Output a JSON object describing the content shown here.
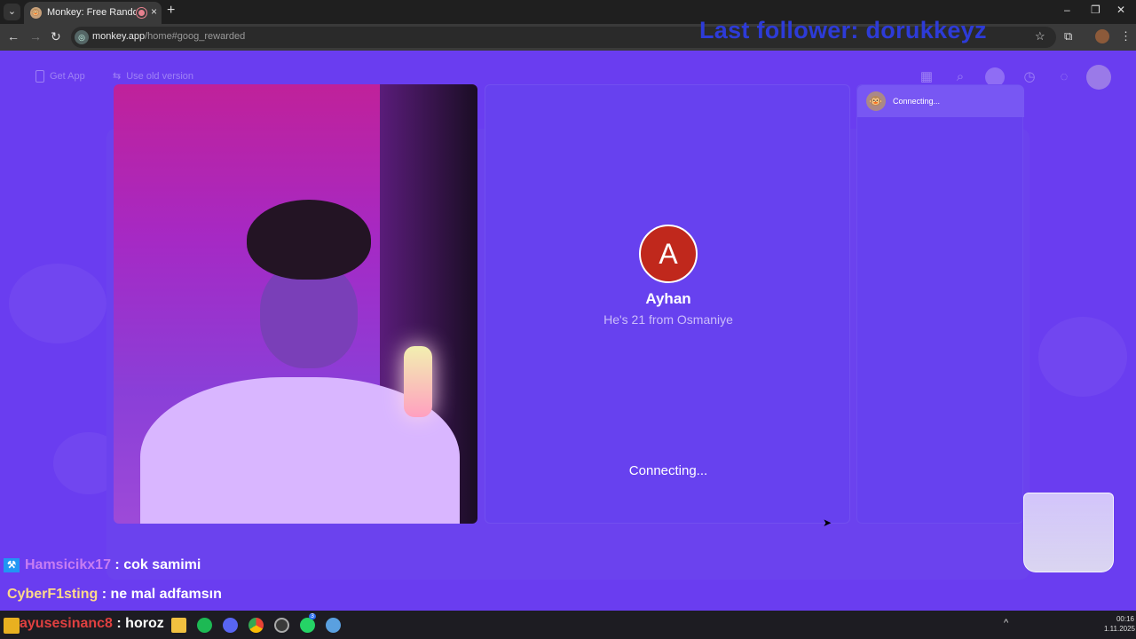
{
  "browser": {
    "tab_title": "Monkey: Free Random Vide",
    "url_host": "monkey.app",
    "url_path": "/home#goog_rewarded",
    "new_tab": "+",
    "close": "×"
  },
  "stream_overlay": {
    "last_follower": "Last follower: dorukkeyz",
    "chat": [
      {
        "user": "Hamsicikx17",
        "message": " : cok samimi"
      },
      {
        "user": "CyberF1sting",
        "message": " : ne mal adfamsın"
      },
      {
        "user": "ayusesinanc8",
        "message": " : horoz"
      }
    ]
  },
  "page_nav": {
    "get_app": "Get App",
    "old_version": "Use old version"
  },
  "match": {
    "avatar_letter": "A",
    "name": "Ayhan",
    "subtitle": "He's 21 from Osmaniye",
    "status": "Connecting..."
  },
  "chat_panel": {
    "status": "Connecting..."
  },
  "taskbar": {
    "clock_time": "00:16",
    "clock_date": "1.11.2025",
    "whatsapp_badge": "3"
  },
  "colors": {
    "page_bg": "#6a3df0",
    "avatar_bg": "#c0281c",
    "follower_text": "#2d3bd8"
  }
}
